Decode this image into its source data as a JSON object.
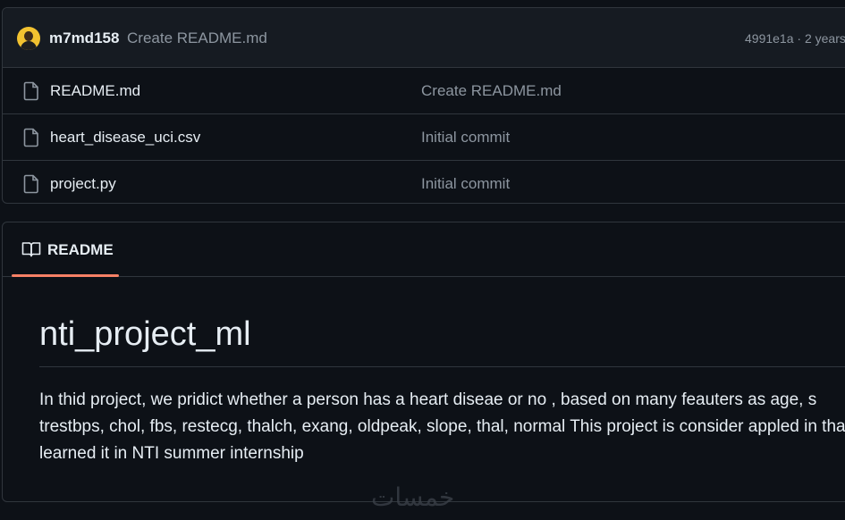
{
  "latest_commit": {
    "author": "m7md158",
    "message": "Create README.md",
    "meta": "4991e1a · 2 years"
  },
  "files": [
    {
      "name": "README.md",
      "commit": "Create README.md"
    },
    {
      "name": "heart_disease_uci.csv",
      "commit": "Initial commit"
    },
    {
      "name": "project.py",
      "commit": "Initial commit"
    }
  ],
  "readme": {
    "tab_label": "README",
    "title": "nti_project_ml",
    "body": "In thid project, we pridict whether a person has a heart diseae or no , based on many feauters as age, s trestbps, chol, fbs, restecg, thalch, exang, oldpeak, slope, thal, normal This project is consider appled in that I learned it in NTI summer internship"
  },
  "watermark": "خمسات",
  "colors": {
    "background": "#0d1117",
    "header_bg": "#161b22",
    "border": "#30363d",
    "muted_text": "#8d96a0",
    "tab_underline": "#f78166"
  }
}
